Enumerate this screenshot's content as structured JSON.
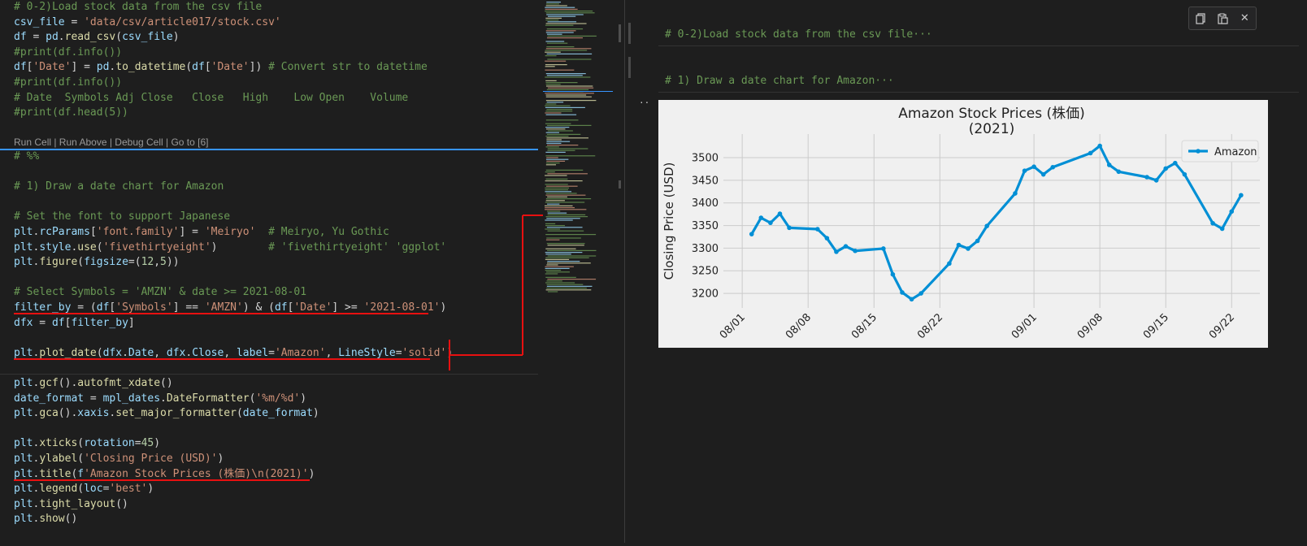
{
  "editor": {
    "lines": [
      {
        "top": 0,
        "segments": [
          [
            "c-com",
            "# 0-2)Load stock data from the csv file"
          ]
        ]
      },
      {
        "top": 0,
        "segments": [
          [
            "c-var",
            "csv_file"
          ],
          [
            "c-plain",
            " = "
          ],
          [
            "c-str",
            "'data/csv/article017/stock.csv'"
          ]
        ]
      },
      {
        "top": 0,
        "segments": [
          [
            "c-var",
            "df"
          ],
          [
            "c-plain",
            " = "
          ],
          [
            "c-var",
            "pd"
          ],
          [
            "c-plain",
            "."
          ],
          [
            "c-fn",
            "read_csv"
          ],
          [
            "c-plain",
            "("
          ],
          [
            "c-var",
            "csv_file"
          ],
          [
            "c-plain",
            ")"
          ]
        ]
      },
      {
        "top": 0,
        "segments": [
          [
            "c-com",
            "#print(df.info())"
          ]
        ]
      },
      {
        "top": 0,
        "segments": [
          [
            "c-var",
            "df"
          ],
          [
            "c-plain",
            "["
          ],
          [
            "c-str",
            "'Date'"
          ],
          [
            "c-plain",
            "] = "
          ],
          [
            "c-var",
            "pd"
          ],
          [
            "c-plain",
            "."
          ],
          [
            "c-fn",
            "to_datetime"
          ],
          [
            "c-plain",
            "("
          ],
          [
            "c-var",
            "df"
          ],
          [
            "c-plain",
            "["
          ],
          [
            "c-str",
            "'Date'"
          ],
          [
            "c-plain",
            "]) "
          ],
          [
            "c-com",
            "# Convert str to datetime"
          ]
        ]
      },
      {
        "top": 0,
        "segments": [
          [
            "c-com",
            "#print(df.info())"
          ]
        ]
      },
      {
        "top": 0,
        "segments": [
          [
            "c-com",
            "# Date  Symbols Adj Close   Close   High    Low Open    Volume"
          ]
        ]
      },
      {
        "top": 0,
        "segments": [
          [
            "c-com",
            "#print(df.head(5))"
          ]
        ]
      }
    ],
    "codelens": "Run Cell | Run Above | Debug Cell | Go to [6]",
    "lines2": [
      {
        "segments": [
          [
            "c-com",
            "# %%"
          ]
        ]
      },
      {
        "segments": [
          [
            "c-plain",
            ""
          ]
        ]
      },
      {
        "segments": [
          [
            "c-com",
            "# 1) Draw a date chart for Amazon"
          ]
        ]
      },
      {
        "segments": [
          [
            "c-plain",
            ""
          ]
        ]
      },
      {
        "segments": [
          [
            "c-com",
            "# Set the font to support Japanese"
          ]
        ]
      },
      {
        "segments": [
          [
            "c-var",
            "plt"
          ],
          [
            "c-plain",
            "."
          ],
          [
            "c-var",
            "rcParams"
          ],
          [
            "c-plain",
            "["
          ],
          [
            "c-str",
            "'font.family'"
          ],
          [
            "c-plain",
            "] = "
          ],
          [
            "c-str",
            "'Meiryo'"
          ],
          [
            "c-plain",
            "  "
          ],
          [
            "c-com",
            "# Meiryo, Yu Gothic"
          ]
        ]
      },
      {
        "segments": [
          [
            "c-var",
            "plt"
          ],
          [
            "c-plain",
            "."
          ],
          [
            "c-var",
            "style"
          ],
          [
            "c-plain",
            "."
          ],
          [
            "c-fn",
            "use"
          ],
          [
            "c-plain",
            "("
          ],
          [
            "c-str",
            "'fivethirtyeight'"
          ],
          [
            "c-plain",
            ")        "
          ],
          [
            "c-com",
            "# 'fivethirtyeight' 'ggplot'"
          ]
        ]
      },
      {
        "segments": [
          [
            "c-var",
            "plt"
          ],
          [
            "c-plain",
            "."
          ],
          [
            "c-fn",
            "figure"
          ],
          [
            "c-plain",
            "("
          ],
          [
            "c-var",
            "figsize"
          ],
          [
            "c-plain",
            "=("
          ],
          [
            "c-num",
            "12"
          ],
          [
            "c-plain",
            ","
          ],
          [
            "c-num",
            "5"
          ],
          [
            "c-plain",
            "))"
          ]
        ]
      },
      {
        "segments": [
          [
            "c-plain",
            ""
          ]
        ]
      },
      {
        "segments": [
          [
            "c-com",
            "# Select Symbols = 'AMZN' & date >= 2021-08-01"
          ]
        ]
      },
      {
        "segments": [
          [
            "c-var",
            "filter_by"
          ],
          [
            "c-plain",
            " = ("
          ],
          [
            "c-var",
            "df"
          ],
          [
            "c-plain",
            "["
          ],
          [
            "c-str",
            "'Symbols'"
          ],
          [
            "c-plain",
            "] == "
          ],
          [
            "c-str",
            "'AMZN'"
          ],
          [
            "c-plain",
            ") & ("
          ],
          [
            "c-var",
            "df"
          ],
          [
            "c-plain",
            "["
          ],
          [
            "c-str",
            "'Date'"
          ],
          [
            "c-plain",
            "] >= "
          ],
          [
            "c-str",
            "'2021-08-01'"
          ],
          [
            "c-plain",
            ")"
          ]
        ]
      },
      {
        "segments": [
          [
            "c-var",
            "dfx"
          ],
          [
            "c-plain",
            " = "
          ],
          [
            "c-var",
            "df"
          ],
          [
            "c-plain",
            "["
          ],
          [
            "c-var",
            "filter_by"
          ],
          [
            "c-plain",
            "]"
          ]
        ]
      },
      {
        "segments": [
          [
            "c-plain",
            ""
          ]
        ]
      },
      {
        "segments": [
          [
            "c-var",
            "plt"
          ],
          [
            "c-plain",
            "."
          ],
          [
            "c-fn",
            "plot_date"
          ],
          [
            "c-plain",
            "("
          ],
          [
            "c-var",
            "dfx"
          ],
          [
            "c-plain",
            "."
          ],
          [
            "c-var",
            "Date"
          ],
          [
            "c-plain",
            ", "
          ],
          [
            "c-var",
            "dfx"
          ],
          [
            "c-plain",
            "."
          ],
          [
            "c-var",
            "Close"
          ],
          [
            "c-plain",
            ", "
          ],
          [
            "c-var",
            "label"
          ],
          [
            "c-plain",
            "="
          ],
          [
            "c-str",
            "'Amazon'"
          ],
          [
            "c-plain",
            ", "
          ],
          [
            "c-var",
            "LineStyle"
          ],
          [
            "c-plain",
            "="
          ],
          [
            "c-str",
            "'solid'"
          ],
          [
            "c-plain",
            ")"
          ]
        ]
      },
      {
        "segments": [
          [
            "c-plain",
            ""
          ]
        ]
      },
      {
        "segments": [
          [
            "c-var",
            "plt"
          ],
          [
            "c-plain",
            "."
          ],
          [
            "c-fn",
            "gcf"
          ],
          [
            "c-plain",
            "()."
          ],
          [
            "c-fn",
            "autofmt_xdate"
          ],
          [
            "c-plain",
            "()"
          ]
        ]
      },
      {
        "segments": [
          [
            "c-var",
            "date_format"
          ],
          [
            "c-plain",
            " = "
          ],
          [
            "c-var",
            "mpl_dates"
          ],
          [
            "c-plain",
            "."
          ],
          [
            "c-fn",
            "DateFormatter"
          ],
          [
            "c-plain",
            "("
          ],
          [
            "c-str",
            "'%m/%d'"
          ],
          [
            "c-plain",
            ")"
          ]
        ]
      },
      {
        "segments": [
          [
            "c-var",
            "plt"
          ],
          [
            "c-plain",
            "."
          ],
          [
            "c-fn",
            "gca"
          ],
          [
            "c-plain",
            "()."
          ],
          [
            "c-var",
            "xaxis"
          ],
          [
            "c-plain",
            "."
          ],
          [
            "c-fn",
            "set_major_formatter"
          ],
          [
            "c-plain",
            "("
          ],
          [
            "c-var",
            "date_format"
          ],
          [
            "c-plain",
            ")"
          ]
        ]
      },
      {
        "segments": [
          [
            "c-plain",
            ""
          ]
        ]
      },
      {
        "segments": [
          [
            "c-var",
            "plt"
          ],
          [
            "c-plain",
            "."
          ],
          [
            "c-fn",
            "xticks"
          ],
          [
            "c-plain",
            "("
          ],
          [
            "c-var",
            "rotation"
          ],
          [
            "c-plain",
            "="
          ],
          [
            "c-num",
            "45"
          ],
          [
            "c-plain",
            ")"
          ]
        ]
      },
      {
        "segments": [
          [
            "c-var",
            "plt"
          ],
          [
            "c-plain",
            "."
          ],
          [
            "c-fn",
            "ylabel"
          ],
          [
            "c-plain",
            "("
          ],
          [
            "c-str",
            "'Closing Price (USD)'"
          ],
          [
            "c-plain",
            ")"
          ]
        ]
      },
      {
        "segments": [
          [
            "c-var",
            "plt"
          ],
          [
            "c-plain",
            "."
          ],
          [
            "c-fn",
            "title"
          ],
          [
            "c-plain",
            "("
          ],
          [
            "c-var",
            "f"
          ],
          [
            "c-str",
            "'Amazon Stock Prices (株価)\\n(2021)'"
          ],
          [
            "c-plain",
            ")"
          ]
        ]
      },
      {
        "segments": [
          [
            "c-var",
            "plt"
          ],
          [
            "c-plain",
            "."
          ],
          [
            "c-fn",
            "legend"
          ],
          [
            "c-plain",
            "("
          ],
          [
            "c-var",
            "loc"
          ],
          [
            "c-plain",
            "="
          ],
          [
            "c-str",
            "'best'"
          ],
          [
            "c-plain",
            ")"
          ]
        ]
      },
      {
        "segments": [
          [
            "c-var",
            "plt"
          ],
          [
            "c-plain",
            "."
          ],
          [
            "c-fn",
            "tight_layout"
          ],
          [
            "c-plain",
            "()"
          ]
        ]
      },
      {
        "segments": [
          [
            "c-var",
            "plt"
          ],
          [
            "c-plain",
            "."
          ],
          [
            "c-fn",
            "show"
          ],
          [
            "c-plain",
            "()"
          ]
        ]
      }
    ]
  },
  "output": {
    "md_cell_1": "# 0-2)Load stock data from the csv file···",
    "md_cell_2": "# 1) Draw a date chart for Amazon···",
    "toolbar": {
      "copy_icon": "copy-icon",
      "paste_icon": "paste-icon",
      "close_icon": "close-icon",
      "close_label": "✕"
    },
    "output_menu": "··"
  },
  "chart_data": {
    "type": "line",
    "title": "Amazon Stock Prices (株価)",
    "subtitle": "(2021)",
    "ylabel": "Closing Price (USD)",
    "xlabel": "",
    "x_ticks": [
      "08/01",
      "08/08",
      "08/15",
      "08/22",
      "09/01",
      "09/08",
      "09/15",
      "09/22"
    ],
    "x_tick_dates": [
      "2021-08-01",
      "2021-08-08",
      "2021-08-15",
      "2021-08-22",
      "2021-09-01",
      "2021-09-08",
      "2021-09-15",
      "2021-09-22"
    ],
    "y_ticks": [
      3200,
      3250,
      3300,
      3350,
      3400,
      3450,
      3500
    ],
    "xlim": [
      "2021-07-30",
      "2021-09-25"
    ],
    "ylim": [
      3175,
      3545
    ],
    "grid": true,
    "legend_loc": "top-right",
    "color": "#008fd5",
    "series": [
      {
        "name": "Amazon",
        "points": [
          [
            "2021-08-02",
            3331
          ],
          [
            "2021-08-03",
            3367
          ],
          [
            "2021-08-04",
            3356
          ],
          [
            "2021-08-05",
            3376
          ],
          [
            "2021-08-06",
            3345
          ],
          [
            "2021-08-09",
            3342
          ],
          [
            "2021-08-10",
            3322
          ],
          [
            "2021-08-11",
            3292
          ],
          [
            "2021-08-12",
            3304
          ],
          [
            "2021-08-13",
            3294
          ],
          [
            "2021-08-16",
            3299
          ],
          [
            "2021-08-17",
            3242
          ],
          [
            "2021-08-18",
            3202
          ],
          [
            "2021-08-19",
            3187
          ],
          [
            "2021-08-20",
            3200
          ],
          [
            "2021-08-23",
            3266
          ],
          [
            "2021-08-24",
            3307
          ],
          [
            "2021-08-25",
            3299
          ],
          [
            "2021-08-26",
            3316
          ],
          [
            "2021-08-27",
            3349
          ],
          [
            "2021-08-30",
            3421
          ],
          [
            "2021-08-31",
            3471
          ],
          [
            "2021-09-01",
            3480
          ],
          [
            "2021-09-02",
            3463
          ],
          [
            "2021-09-03",
            3479
          ],
          [
            "2021-09-07",
            3510
          ],
          [
            "2021-09-08",
            3526
          ],
          [
            "2021-09-09",
            3484
          ],
          [
            "2021-09-10",
            3469
          ],
          [
            "2021-09-13",
            3457
          ],
          [
            "2021-09-14",
            3450
          ],
          [
            "2021-09-15",
            3476
          ],
          [
            "2021-09-16",
            3488
          ],
          [
            "2021-09-17",
            3463
          ],
          [
            "2021-09-20",
            3355
          ],
          [
            "2021-09-21",
            3343
          ],
          [
            "2021-09-22",
            3381
          ],
          [
            "2021-09-23",
            3417
          ]
        ]
      }
    ]
  }
}
